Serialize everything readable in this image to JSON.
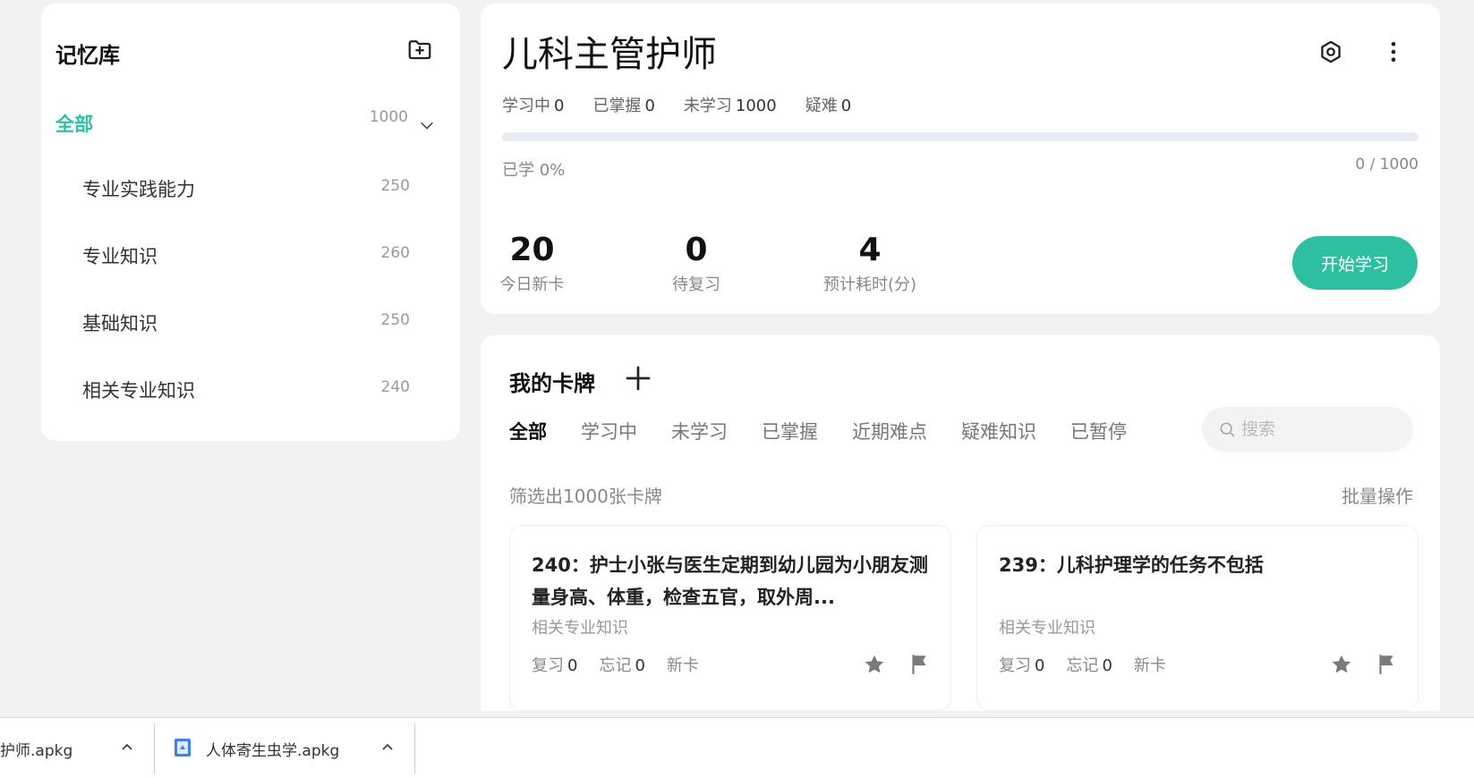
{
  "sidebar": {
    "title": "记忆库",
    "all": {
      "label": "全部",
      "count": "1000"
    },
    "decks": [
      {
        "label": "专业实践能力",
        "count": "250"
      },
      {
        "label": "专业知识",
        "count": "260"
      },
      {
        "label": "基础知识",
        "count": "250"
      },
      {
        "label": "相关专业知识",
        "count": "240"
      }
    ]
  },
  "deck": {
    "title": "儿科主管护师",
    "stats": {
      "learning_label": "学习中",
      "learning": "0",
      "mastered_label": "已掌握",
      "mastered": "0",
      "unlearned_label": "未学习",
      "unlearned": "1000",
      "difficult_label": "疑难",
      "difficult": "0"
    },
    "progress_label": "已学 0%",
    "progress_fraction": 0,
    "progress_count": "0 / 1000",
    "today_new": {
      "value": "20",
      "label": "今日新卡"
    },
    "to_review": {
      "value": "0",
      "label": "待复习"
    },
    "est_minutes": {
      "value": "4",
      "label": "预计耗时(分)"
    },
    "start_label": "开始学习",
    "accent_color": "#2dbf9f"
  },
  "cards": {
    "title": "我的卡牌",
    "tabs": [
      "全部",
      "学习中",
      "未学习",
      "已掌握",
      "近期难点",
      "疑难知识",
      "已暂停"
    ],
    "search_placeholder": "搜索",
    "filter_summary": "筛选出1000张卡牌",
    "batch_label": "批量操作",
    "items": [
      {
        "question": "240：护士小张与医生定期到幼儿园为小朋友测量身高、体重，检查五官，取外周...",
        "category": "相关专业知识",
        "review_label": "复习",
        "review": "0",
        "forget_label": "忘记",
        "forget": "0",
        "status": "新卡"
      },
      {
        "question": "239：儿科护理学的任务不包括",
        "category": "相关专业知识",
        "review_label": "复习",
        "review": "0",
        "forget_label": "忘记",
        "forget": "0",
        "status": "新卡"
      }
    ]
  },
  "downloads": [
    {
      "filename": "护师.apkg"
    },
    {
      "filename": "人体寄生虫学.apkg"
    }
  ]
}
